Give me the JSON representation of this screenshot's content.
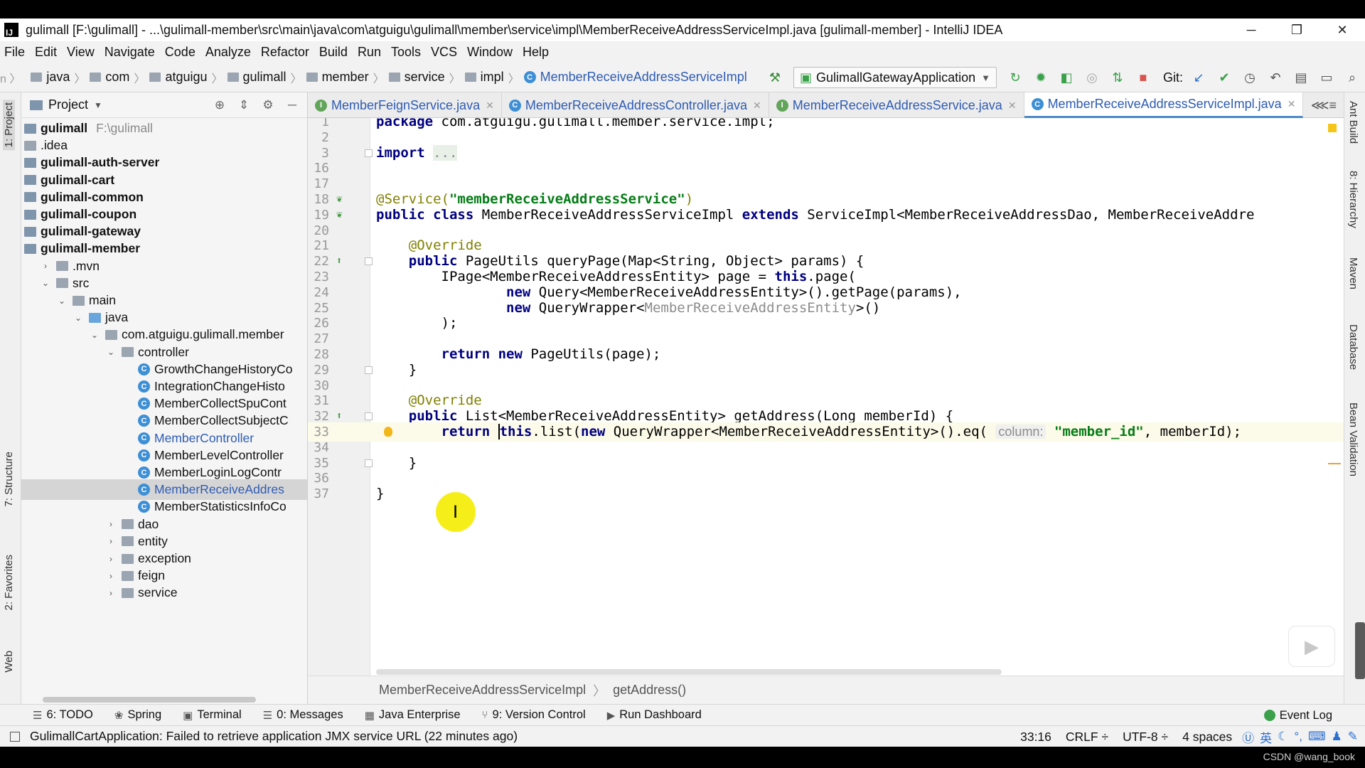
{
  "window": {
    "title": "gulimall [F:\\gulimall] - ...\\gulimall-member\\src\\main\\java\\com\\atguigu\\gulimall\\member\\service\\impl\\MemberReceiveAddressServiceImpl.java [gulimall-member] - IntelliJ IDEA",
    "minimize": "─",
    "restore": "❐",
    "close": "✕"
  },
  "menu": [
    "File",
    "Edit",
    "View",
    "Navigate",
    "Code",
    "Analyze",
    "Refactor",
    "Build",
    "Run",
    "Tools",
    "VCS",
    "Window",
    "Help"
  ],
  "nav": {
    "crumbs": [
      "java",
      "com",
      "atguigu",
      "gulimall",
      "member",
      "service",
      "impl"
    ],
    "current_class": "MemberReceiveAddressServiceImpl",
    "run_config": "GulimallGatewayApplication",
    "git_label": "Git:"
  },
  "project": {
    "title": "Project",
    "root_name": "gulimall",
    "root_path": "F:\\gulimall",
    "items": [
      {
        "label": ".idea",
        "depth": 0,
        "kind": "folder",
        "arrow": ""
      },
      {
        "label": "gulimall-auth-server",
        "depth": 0,
        "kind": "module",
        "arrow": ""
      },
      {
        "label": "gulimall-cart",
        "depth": 0,
        "kind": "module",
        "arrow": ""
      },
      {
        "label": "gulimall-common",
        "depth": 0,
        "kind": "module",
        "arrow": ""
      },
      {
        "label": "gulimall-coupon",
        "depth": 0,
        "kind": "module",
        "arrow": ""
      },
      {
        "label": "gulimall-gateway",
        "depth": 0,
        "kind": "module",
        "arrow": ""
      },
      {
        "label": "gulimall-member",
        "depth": 0,
        "kind": "module",
        "arrow": ""
      },
      {
        "label": ".mvn",
        "depth": 1,
        "kind": "folder",
        "arrow": "›"
      },
      {
        "label": "src",
        "depth": 1,
        "kind": "folder",
        "arrow": "⌄"
      },
      {
        "label": "main",
        "depth": 2,
        "kind": "folder",
        "arrow": "⌄"
      },
      {
        "label": "java",
        "depth": 3,
        "kind": "blue",
        "arrow": "⌄"
      },
      {
        "label": "com.atguigu.gulimall.member",
        "depth": 4,
        "kind": "folder",
        "arrow": "⌄"
      },
      {
        "label": "controller",
        "depth": 5,
        "kind": "folder",
        "arrow": "⌄"
      },
      {
        "label": "GrowthChangeHistoryCo",
        "depth": 6,
        "kind": "class",
        "arrow": ""
      },
      {
        "label": "IntegrationChangeHisto",
        "depth": 6,
        "kind": "class",
        "arrow": ""
      },
      {
        "label": "MemberCollectSpuCont",
        "depth": 6,
        "kind": "class",
        "arrow": ""
      },
      {
        "label": "MemberCollectSubjectC",
        "depth": 6,
        "kind": "class",
        "arrow": ""
      },
      {
        "label": "MemberController",
        "depth": 6,
        "kind": "class-blue",
        "arrow": ""
      },
      {
        "label": "MemberLevelController",
        "depth": 6,
        "kind": "class",
        "arrow": ""
      },
      {
        "label": "MemberLoginLogContr",
        "depth": 6,
        "kind": "class",
        "arrow": ""
      },
      {
        "label": "MemberReceiveAddres",
        "depth": 6,
        "kind": "class-selected",
        "arrow": ""
      },
      {
        "label": "MemberStatisticsInfoCo",
        "depth": 6,
        "kind": "class",
        "arrow": ""
      },
      {
        "label": "dao",
        "depth": 5,
        "kind": "folder",
        "arrow": "›"
      },
      {
        "label": "entity",
        "depth": 5,
        "kind": "folder",
        "arrow": "›"
      },
      {
        "label": "exception",
        "depth": 5,
        "kind": "folder",
        "arrow": "›"
      },
      {
        "label": "feign",
        "depth": 5,
        "kind": "folder",
        "arrow": "›"
      },
      {
        "label": "service",
        "depth": 5,
        "kind": "folder",
        "arrow": "›"
      }
    ]
  },
  "tabs": [
    {
      "label": "MemberFeignService.java",
      "icon": "I",
      "active": false
    },
    {
      "label": "MemberReceiveAddressController.java",
      "icon": "C",
      "active": false
    },
    {
      "label": "MemberReceiveAddressService.java",
      "icon": "I",
      "active": false
    },
    {
      "label": "MemberReceiveAddressServiceImpl.java",
      "icon": "C",
      "active": true
    }
  ],
  "editor": {
    "lines": [
      {
        "n": "1",
        "html": "<span class=\"kw\">package</span> com.atguigu.gulimall.member.service.impl;"
      },
      {
        "n": "2",
        "html": ""
      },
      {
        "n": "3",
        "html": "<span class=\"kw\">import</span> <span class=\"gray\" style=\"background:#e8f0e8\">...</span>"
      },
      {
        "n": "16",
        "html": ""
      },
      {
        "n": "17",
        "html": ""
      },
      {
        "n": "18",
        "html": "<span class=\"an\">@Service(</span><span class=\"str\">\"memberReceiveAddressService\"</span><span class=\"an\">)</span>"
      },
      {
        "n": "19",
        "html": "<span class=\"kw\">public class</span> MemberReceiveAddressServiceImpl <span class=\"kw\">extends</span> ServiceImpl&lt;MemberReceiveAddressDao, MemberReceiveAddre"
      },
      {
        "n": "20",
        "html": ""
      },
      {
        "n": "21",
        "html": "    <span class=\"an\">@Override</span>"
      },
      {
        "n": "22",
        "html": "    <span class=\"kw\">public</span> PageUtils queryPage(Map&lt;String, Object&gt; params) {"
      },
      {
        "n": "23",
        "html": "        IPage&lt;MemberReceiveAddressEntity&gt; page = <span class=\"kw\">this</span>.page("
      },
      {
        "n": "24",
        "html": "                <span class=\"kw\">new</span> Query&lt;MemberReceiveAddressEntity&gt;().getPage(params),"
      },
      {
        "n": "25",
        "html": "                <span class=\"kw\">new</span> QueryWrapper&lt;<span class=\"gray\">MemberReceiveAddressEntity</span>&gt;()"
      },
      {
        "n": "26",
        "html": "        );"
      },
      {
        "n": "27",
        "html": ""
      },
      {
        "n": "28",
        "html": "        <span class=\"kw\">return new</span> PageUtils(page);"
      },
      {
        "n": "29",
        "html": "    }"
      },
      {
        "n": "30",
        "html": ""
      },
      {
        "n": "31",
        "html": "    <span class=\"an\">@Override</span>"
      },
      {
        "n": "32",
        "html": "    <span class=\"kw\">public</span> List&lt;MemberReceiveAddressEntity&gt; getAddress(Long memberId) {"
      },
      {
        "n": "33",
        "html": "        <span class=\"kw\">return</span> <span class=\"kw\" style=\"border-left:2px solid #000\">this</span>.list(<span class=\"kw\">new</span> QueryWrapper&lt;MemberReceiveAddressEntity&gt;().eq( <span class=\"hint\">column:</span> <span class=\"str\">\"member_id\"</span>, memberId);"
      },
      {
        "n": "34",
        "html": ""
      },
      {
        "n": "35",
        "html": "    }"
      },
      {
        "n": "36",
        "html": ""
      },
      {
        "n": "37",
        "html": "}"
      }
    ]
  },
  "crumbbar": {
    "class": "MemberReceiveAddressServiceImpl",
    "method": "getAddress()"
  },
  "right_tabs": [
    "Ant Build",
    "8: Hierarchy",
    "Maven",
    "Database",
    "Bean Validation"
  ],
  "left_tabs": [
    "1: Project",
    "7: Structure",
    "2: Favorites",
    "Web"
  ],
  "toolwindows": [
    {
      "icon": "☰",
      "label": "6: TODO"
    },
    {
      "icon": "❀",
      "label": "Spring"
    },
    {
      "icon": "▣",
      "label": "Terminal"
    },
    {
      "icon": "☰",
      "label": "0: Messages"
    },
    {
      "icon": "▦",
      "label": "Java Enterprise"
    },
    {
      "icon": "⑂",
      "label": "9: Version Control"
    },
    {
      "icon": "▶",
      "label": "Run Dashboard"
    }
  ],
  "event_log": "Event Log",
  "status": {
    "message": "GulimallCartApplication: Failed to retrieve application JMX service URL (22 minutes ago)",
    "position": "33:16",
    "line_sep": "CRLF ÷",
    "encoding": "UTF-8 ÷",
    "indent": "4 spaces",
    "ime": "英"
  },
  "watermark": "CSDN @wang_book"
}
